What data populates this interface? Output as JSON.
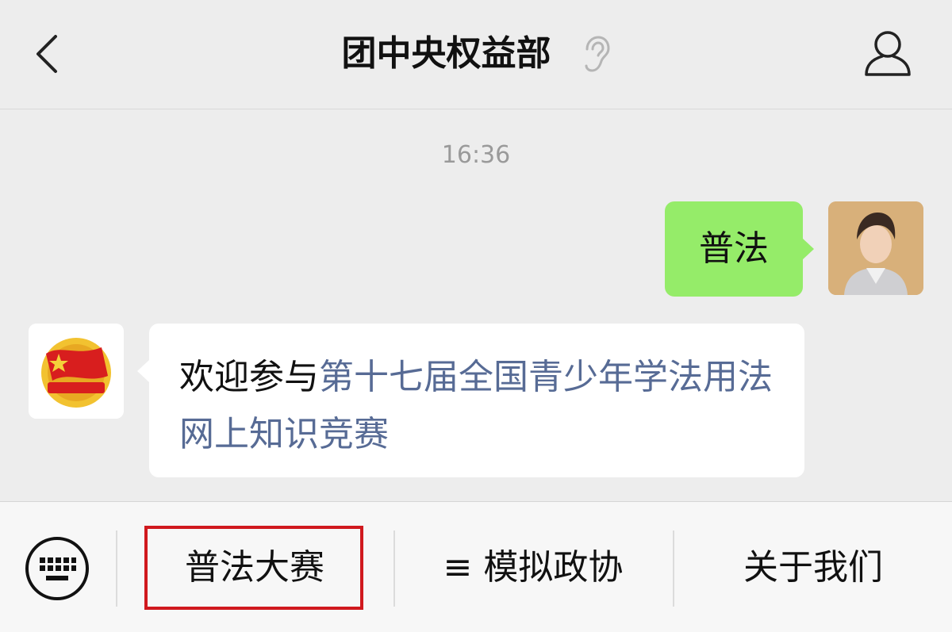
{
  "header": {
    "title": "团中央权益部",
    "back_icon": "chevron-left-icon",
    "ear_icon": "ear-icon",
    "profile_icon": "person-icon"
  },
  "chat": {
    "timestamp": "16:36",
    "outgoing": {
      "text": "普法",
      "color": "#95ec69"
    },
    "incoming": {
      "prefix": "欢迎参与",
      "link": "第十七届全国青少年学法用法网上知识竞赛",
      "link_color": "#576b95"
    }
  },
  "menu": {
    "keyboard_icon": "keyboard-icon",
    "items": [
      {
        "label": "普法大赛"
      },
      {
        "label": "≡ 模拟政协"
      },
      {
        "label": "关于我们"
      }
    ],
    "highlight_color": "#d0191e"
  }
}
